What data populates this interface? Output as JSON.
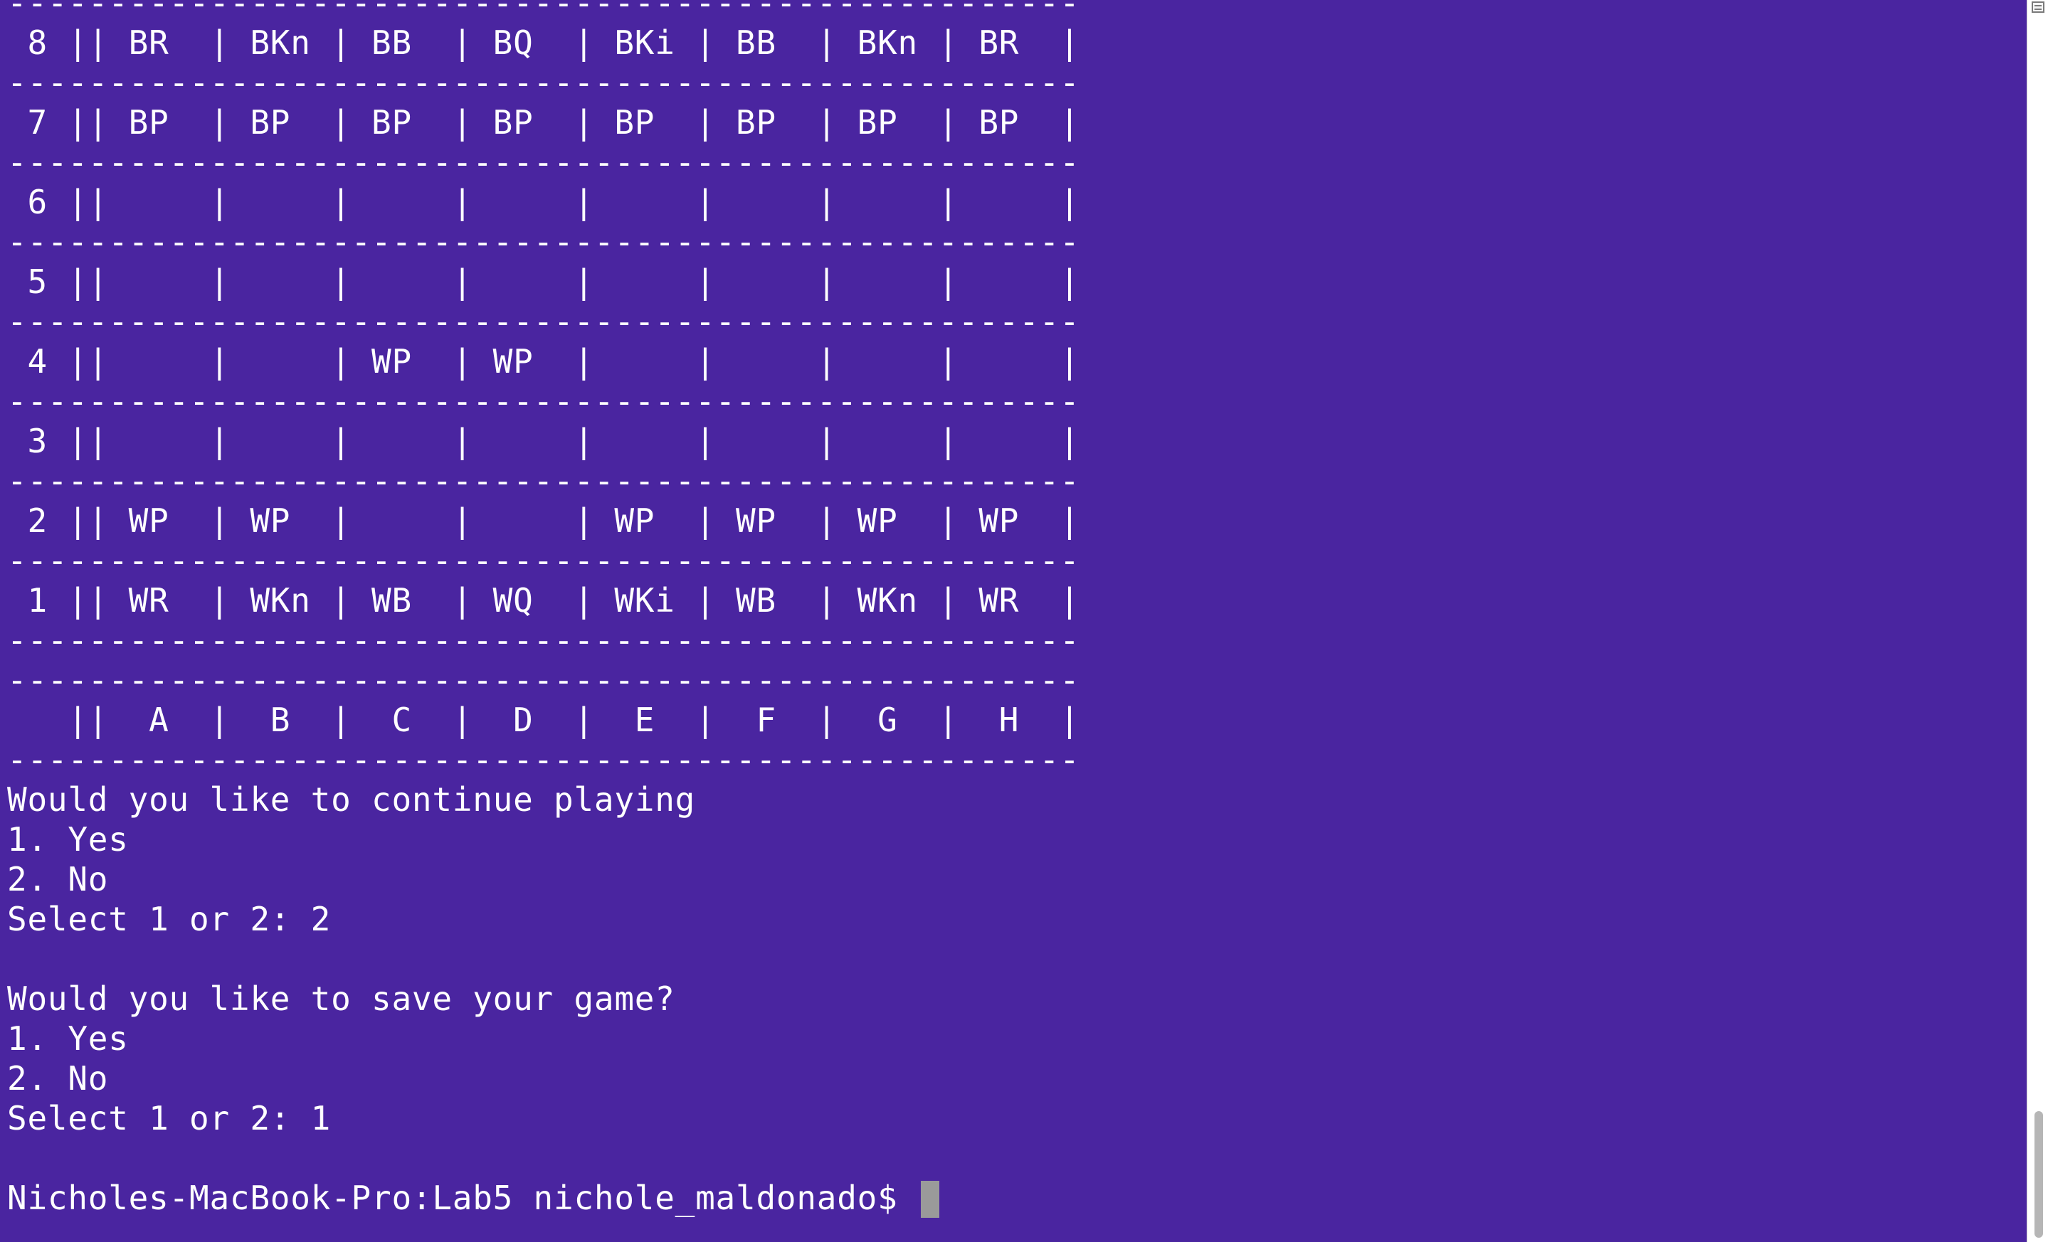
{
  "terminal": {
    "lines": [
      "-----------------------------------------------------",
      " 8 || BR  | BKn | BB  | BQ  | BKi | BB  | BKn | BR  |",
      "-----------------------------------------------------",
      " 7 || BP  | BP  | BP  | BP  | BP  | BP  | BP  | BP  |",
      "-----------------------------------------------------",
      " 6 ||     |     |     |     |     |     |     |     |",
      "-----------------------------------------------------",
      " 5 ||     |     |     |     |     |     |     |     |",
      "-----------------------------------------------------",
      " 4 ||     |     | WP  | WP  |     |     |     |     |",
      "-----------------------------------------------------",
      " 3 ||     |     |     |     |     |     |     |     |",
      "-----------------------------------------------------",
      " 2 || WP  | WP  |     |     | WP  | WP  | WP  | WP  |",
      "-----------------------------------------------------",
      " 1 || WR  | WKn | WB  | WQ  | WKi | WB  | WKn | WR  |",
      "-----------------------------------------------------",
      "-----------------------------------------------------",
      "   ||  A  |  B  |  C  |  D  |  E  |  F  |  G  |  H  |",
      "-----------------------------------------------------",
      "Would you like to continue playing",
      "1. Yes",
      "2. No",
      "Select 1 or 2: 2",
      "",
      "Would you like to save your game?",
      "1. Yes",
      "2. No",
      "Select 1 or 2: 1",
      ""
    ],
    "prompt": "Nicholes-MacBook-Pro:Lab5 nichole_maldonado$ "
  },
  "colors": {
    "background": "#4a25a0",
    "text": "#ffffff",
    "cursor": "#9a9a9a"
  }
}
